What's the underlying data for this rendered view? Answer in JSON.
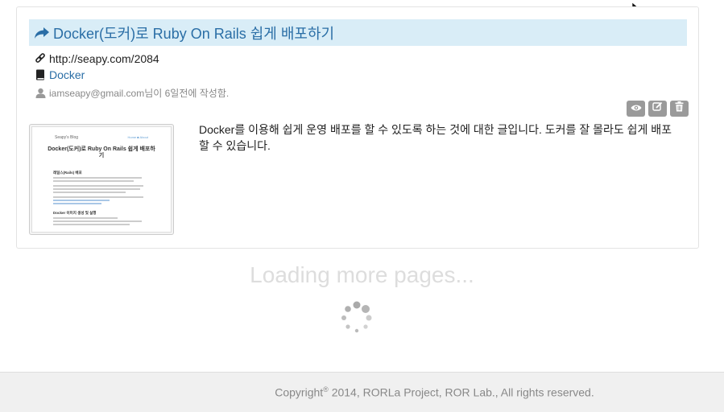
{
  "post": {
    "title": "Docker(도커)로 Ruby On Rails 쉽게 배포하기",
    "url": "http://seapy.com/2084",
    "category": "Docker",
    "author": "iamseapy@gmail.com님이 6일전에 작성함.",
    "description": "Docker를 이용해 쉽게 운영 배포를 할 수 있도록 하는 것에 대한 글입니다. 도커를 잘 몰라도 쉽게 배포 할 수 있습니다.",
    "icons": {
      "title": "share-arrow-icon",
      "url": "link-icon",
      "category": "book-icon",
      "author": "user-icon"
    },
    "actions": [
      {
        "name": "view",
        "icon": "eye-icon"
      },
      {
        "name": "edit",
        "icon": "edit-icon"
      },
      {
        "name": "delete",
        "icon": "trash-icon"
      }
    ],
    "thumbnail": {
      "blog_name": "Seapy's Blog",
      "nav": "Home  ■  About",
      "title": "Docker(도커)로 Ruby On Rails 쉽게 배포하기",
      "section1": "레일스(Rails) 배포",
      "section2": "Docker 이미지 생성 및 실행"
    }
  },
  "loading": {
    "text": "Loading more pages..."
  },
  "footer": {
    "copyright_prefix": "Copyright",
    "registered": "®",
    "copyright_suffix": " 2014, RORLa Project, ROR Lab., All rights reserved."
  },
  "colors": {
    "link": "#2a6ea6",
    "title_bg": "#d9edf7",
    "button_bg": "#9a9a9a"
  }
}
